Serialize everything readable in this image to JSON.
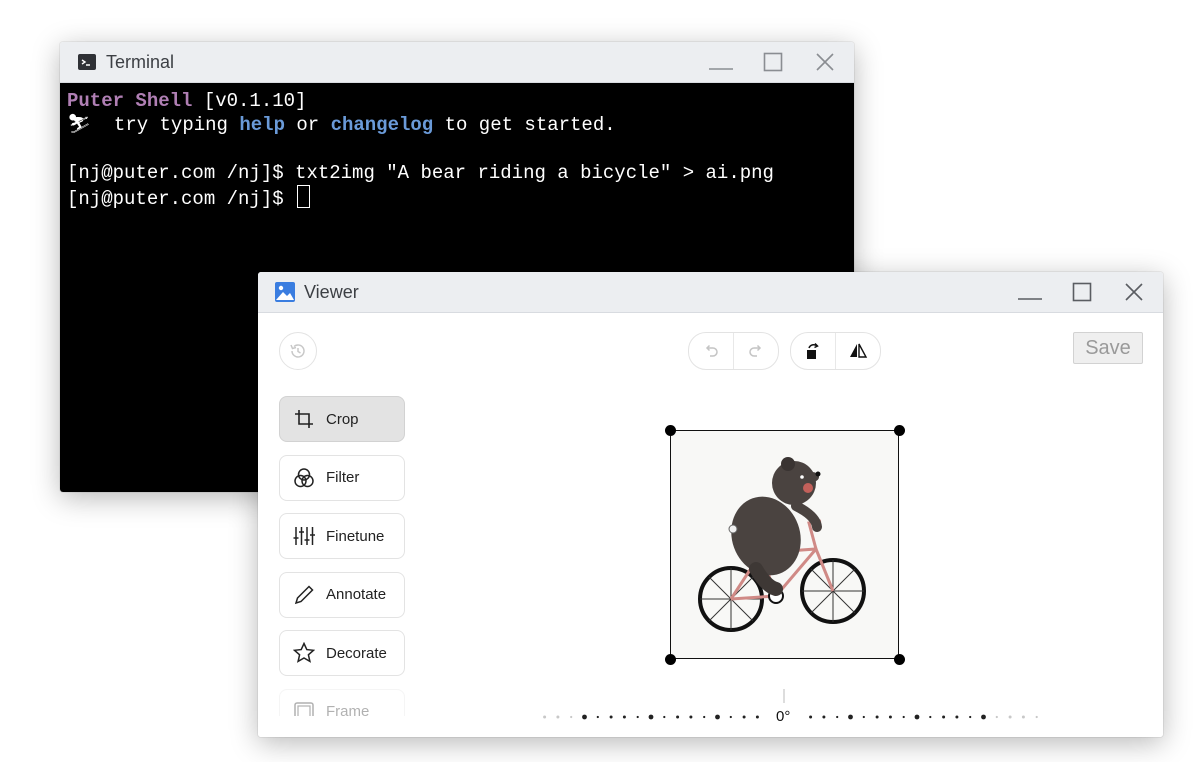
{
  "terminal": {
    "title": "Terminal",
    "lines": {
      "l1": {
        "shell_name": "Puter Shell",
        "version": " [v0.1.10]"
      },
      "l2": {
        "prefix": "⛷  try typing ",
        "cmd1": "help",
        "mid": " or ",
        "cmd2": "changelog",
        "suffix": " to get started."
      },
      "l4": {
        "prompt": "[nj@puter.com /nj]$ ",
        "command": "txt2img \"A bear riding a bicycle\" > ai.png"
      },
      "l5": {
        "prompt": "[nj@puter.com /nj]$ "
      }
    },
    "colors": {
      "background": "#000000",
      "text": "#ffffff",
      "shell_name": "#b07fb4",
      "command_hint": "#6a9ad8"
    }
  },
  "viewer": {
    "title": "Viewer",
    "save_label": "Save",
    "toolbar": {
      "history_icon": "history-icon",
      "undo_icon": "undo-icon",
      "redo_icon": "redo-icon",
      "rotate_icon": "rotate-left-icon",
      "flip_icon": "flip-horizontal-icon"
    },
    "sidebar": [
      {
        "label": "Crop",
        "icon": "crop-icon",
        "active": true
      },
      {
        "label": "Filter",
        "icon": "filter-icon",
        "active": false
      },
      {
        "label": "Finetune",
        "icon": "sliders-icon",
        "active": false
      },
      {
        "label": "Annotate",
        "icon": "pencil-icon",
        "active": false
      },
      {
        "label": "Decorate",
        "icon": "star-icon",
        "active": false
      },
      {
        "label": "Frame",
        "icon": "frame-icon",
        "active": false
      }
    ],
    "rotation_value": "0°",
    "image_subject": "bear-riding-bicycle"
  },
  "window_controls": {
    "minimize": "minimize-icon",
    "maximize": "maximize-icon",
    "close": "close-icon"
  }
}
